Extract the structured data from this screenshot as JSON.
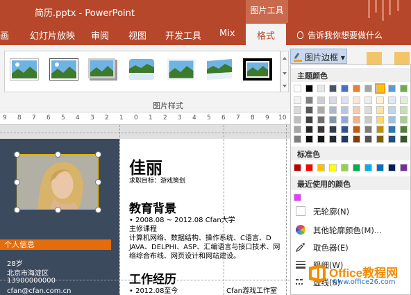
{
  "titlebar": {
    "title": "简历.pptx  -  PowerPoint",
    "context_title": "图片工具"
  },
  "tabs": [
    "画",
    "幻灯片放映",
    "审阅",
    "视图",
    "开发工具",
    "Mix",
    "格式"
  ],
  "tellme": "告诉我你想要做什么",
  "ribbon": {
    "group_label": "图片样式",
    "border_button": "图片边框",
    "dropdown_arrow": "▾",
    "gallery_styles": [
      "simple-frame-white",
      "simple-frame-black-thin",
      "drop-shadow-rectangle",
      "reflected-rounded",
      "soft-edge-rectangle",
      "reflected-bevel",
      "thick-black-frame"
    ]
  },
  "ruler": [
    "9",
    "8",
    "7",
    "6",
    "5",
    "4",
    "3",
    "2",
    "1",
    "0",
    "1",
    "2",
    "3",
    "4",
    "5",
    "6",
    "7",
    "8",
    "9",
    "10"
  ],
  "slide": {
    "name": "佳丽",
    "subtitle": "求职目标：游戏策划",
    "section_edu": "教育背景",
    "edu_line1": "•   2008.08 ~ 2012.08 Cfan大学",
    "edu_line2": "主修课程",
    "edu_line3": "计算机网络、数据结构、操作系统、C语言、D",
    "edu_line4": "JAVA、DELPHI、ASP、汇编语言与接口技术、网",
    "edu_line5": "络综合布线、网页设计和网站建设。",
    "section_work": "工作经历",
    "work_line1": "•   2012.08至今",
    "work_company": "Cfan游戏工作室",
    "personal_info": "个人信息",
    "age": "28岁",
    "location": "北京市海淀区",
    "phone": "13900000000",
    "email": "cfan@cfan.com.cn"
  },
  "menu": {
    "theme_colors_label": "主题颜色",
    "theme_colors_top": [
      "#ffffff",
      "#000000",
      "#e7e6e6",
      "#44546a",
      "#4472c4",
      "#ed7d31",
      "#a5a5a5",
      "#ffc000",
      "#5b9bd5",
      "#70ad47"
    ],
    "theme_shades": [
      [
        "#f2f2f2",
        "#808080",
        "#d0cece",
        "#d6dce4",
        "#d9e2f3",
        "#fbe5d5",
        "#ededed",
        "#fff2cc",
        "#deebf6",
        "#e2efd9"
      ],
      [
        "#d9d9d9",
        "#595959",
        "#aeabab",
        "#adb9ca",
        "#b4c6e7",
        "#f7cbac",
        "#dbdbdb",
        "#fee599",
        "#bdd7ee",
        "#c5e0b3"
      ],
      [
        "#bfbfbf",
        "#404040",
        "#757070",
        "#8496b0",
        "#8eaadb",
        "#f4b183",
        "#c9c9c9",
        "#ffd965",
        "#9cc3e5",
        "#a8d08d"
      ],
      [
        "#a6a6a6",
        "#262626",
        "#3a3838",
        "#323f4f",
        "#2f5496",
        "#c55a11",
        "#7b7b7b",
        "#bf9000",
        "#2e75b5",
        "#538135"
      ],
      [
        "#7f7f7f",
        "#0d0d0d",
        "#171616",
        "#222a35",
        "#1f3864",
        "#833c0b",
        "#525252",
        "#7f6000",
        "#1e4e79",
        "#375623"
      ]
    ],
    "standard_colors_label": "标准色",
    "standard_colors": [
      "#c00000",
      "#ff0000",
      "#ffc000",
      "#ffff00",
      "#92d050",
      "#00b050",
      "#00b0f0",
      "#0070c0",
      "#002060",
      "#7030a0"
    ],
    "recent_colors_label": "最近使用的颜色",
    "recent_colors": [
      "#e040fb"
    ],
    "no_outline": "无轮廓(N)",
    "more_colors": "其他轮廓颜色(M)...",
    "eyedropper": "取色器(E)",
    "weight": "粗细(W)",
    "dashes": "虚线(S)",
    "selected_theme_color": "#ffc000"
  },
  "watermark": {
    "brand": "Office教程网",
    "url": "www.office26.com"
  }
}
